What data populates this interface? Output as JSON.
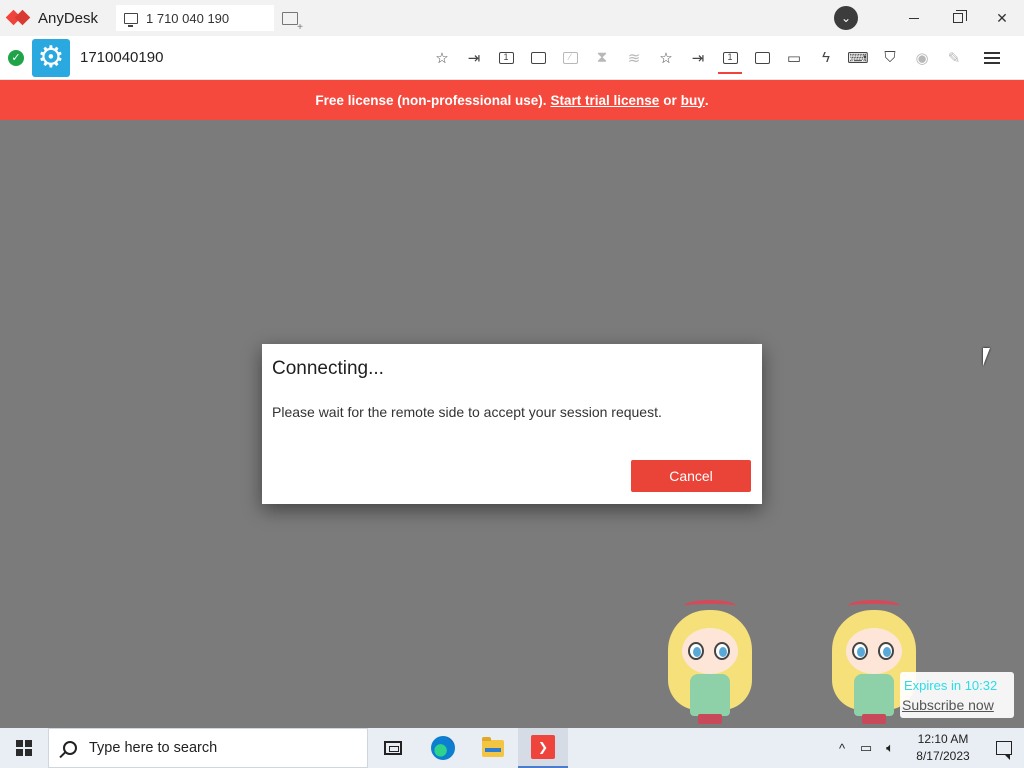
{
  "titlebar": {
    "app_name": "AnyDesk",
    "tab_label": "1 710 040 190",
    "icons": [
      "anydesk-logo-icon",
      "monitor-icon",
      "new-session-icon",
      "download-badge-icon",
      "minimize-icon",
      "restore-icon",
      "close-icon"
    ]
  },
  "toolbar": {
    "session_id": "1710040190",
    "tool_icons": [
      "favorite-icon",
      "actions-icon",
      "display-1-icon",
      "monitor-icon",
      "hidden-screen-icon",
      "hourglass-icon",
      "database-icon",
      "favorite-icon",
      "transfer-icon",
      "display-1-icon",
      "fullscreen-icon",
      "chat-icon",
      "lightning-icon",
      "keyboard-icon",
      "shield-icon",
      "record-icon",
      "pen-icon",
      "menu-icon"
    ],
    "display_number": "1"
  },
  "banner": {
    "text_prefix": "Free license (non-professional use).",
    "trial_link": "Start trial license",
    "or_text": "or",
    "buy_link": "buy",
    "suffix": "."
  },
  "dialog": {
    "title": "Connecting...",
    "message": "Please wait for the remote side to accept your session request.",
    "cancel_label": "Cancel"
  },
  "overlay": {
    "expires_text": "Expires in 10:32",
    "subscribe_text": "Subscribe now"
  },
  "taskbar": {
    "search_placeholder": "Type here to search",
    "time": "12:10 AM",
    "date": "8/17/2023",
    "colors": {
      "accent": "#ef443b",
      "banner": "#f5493d",
      "button": "#ea4337"
    }
  }
}
